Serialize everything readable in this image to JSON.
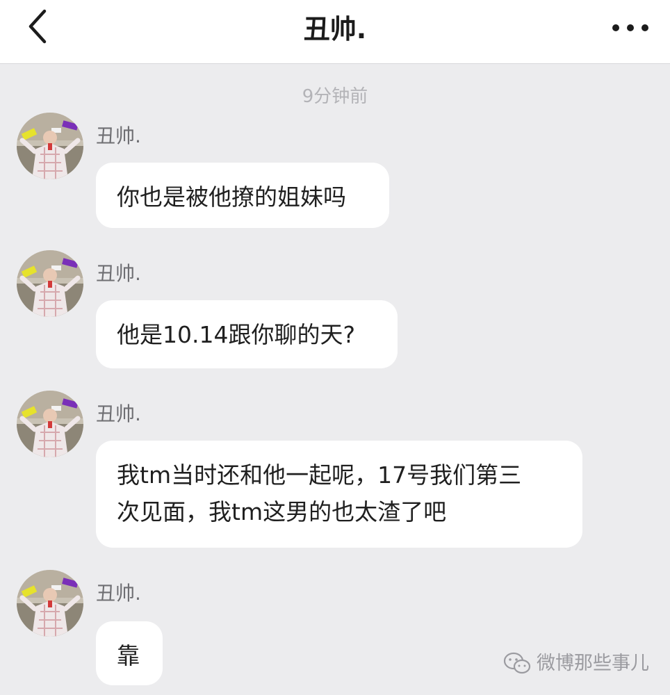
{
  "header": {
    "title": "丑帅."
  },
  "timestamp": "9分钟前",
  "messages": [
    {
      "sender": "丑帅.",
      "text": "你也是被他撩的姐妹吗"
    },
    {
      "sender": "丑帅.",
      "text": "他是10.14跟你聊的天?"
    },
    {
      "sender": "丑帅.",
      "text": "我tm当时还和他一起呢，17号我们第三\n次见面，我tm这男的也太渣了吧"
    },
    {
      "sender": "丑帅.",
      "text": "靠"
    }
  ],
  "watermark": "微博那些事儿",
  "icons": {
    "back": "back-chevron-icon",
    "more": "more-dots-icon",
    "watermark": "wechat-icon"
  }
}
